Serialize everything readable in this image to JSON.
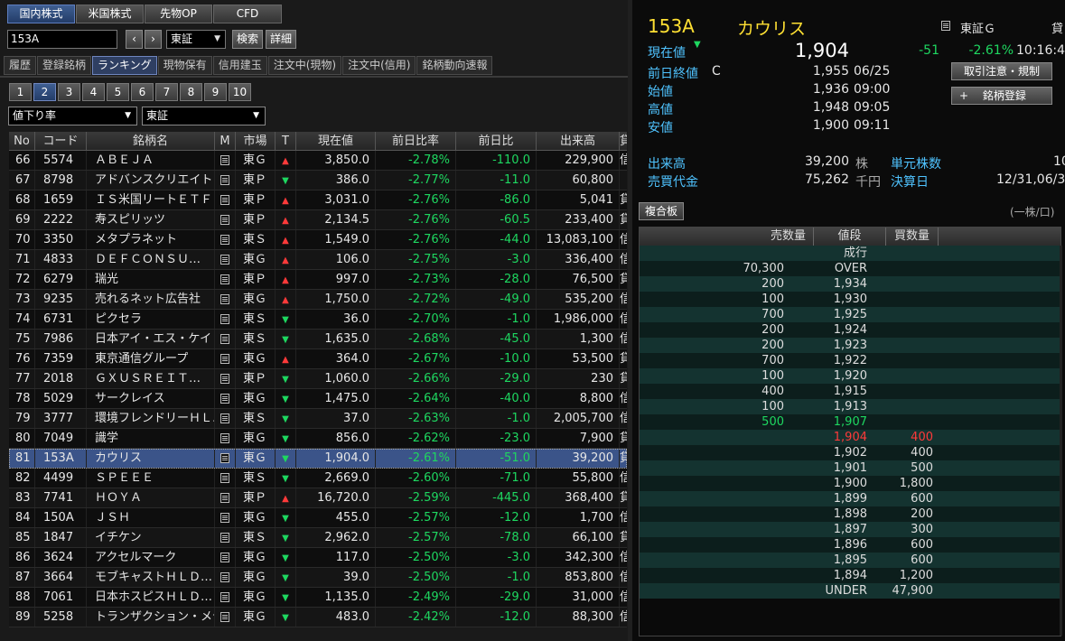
{
  "main_tabs": [
    "国内株式",
    "米国株式",
    "先物OP",
    "CFD"
  ],
  "search": {
    "code": "153A",
    "exchange": "東証",
    "search_label": "検索",
    "detail_label": "詳細"
  },
  "sub_tabs": [
    "履歴",
    "登録銘柄",
    "ランキング",
    "現物保有",
    "信用建玉",
    "注文中(現物)",
    "注文中(信用)",
    "銘柄動向速報"
  ],
  "pages": [
    "1",
    "2",
    "3",
    "4",
    "5",
    "6",
    "7",
    "8",
    "9",
    "10"
  ],
  "filters": {
    "ranking_type": "値下り率",
    "market": "東証"
  },
  "table": {
    "headers": [
      "No",
      "コード",
      "銘柄名",
      "M",
      "市場",
      "T",
      "現在値",
      "前日比率",
      "前日比",
      "出来高",
      "貸"
    ],
    "rows": [
      {
        "no": "66",
        "code": "5574",
        "name": "ＡＢＥＪＡ",
        "market": "東Ｇ",
        "tick": "up",
        "price": "3,850.0",
        "pct": "-2.78%",
        "chg": "-110.0",
        "vol": "229,900",
        "x": "信"
      },
      {
        "no": "67",
        "code": "8798",
        "name": "アドバンスクリエイト",
        "market": "東Ｐ",
        "tick": "down",
        "price": "386.0",
        "pct": "-2.77%",
        "chg": "-11.0",
        "vol": "60,800",
        "x": ""
      },
      {
        "no": "68",
        "code": "1659",
        "name": "ＩＳ米国リートＥＴＦ",
        "market": "東Ｐ",
        "tick": "up",
        "price": "3,031.0",
        "pct": "-2.76%",
        "chg": "-86.0",
        "vol": "5,041",
        "x": "貸"
      },
      {
        "no": "69",
        "code": "2222",
        "name": "寿スピリッツ",
        "market": "東Ｐ",
        "tick": "up",
        "price": "2,134.5",
        "pct": "-2.76%",
        "chg": "-60.5",
        "vol": "233,400",
        "x": "貸"
      },
      {
        "no": "70",
        "code": "3350",
        "name": "メタプラネット",
        "market": "東Ｓ",
        "tick": "up",
        "price": "1,549.0",
        "pct": "-2.76%",
        "chg": "-44.0",
        "vol": "13,083,100",
        "x": "信"
      },
      {
        "no": "71",
        "code": "4833",
        "name": "ＤＥＦＣＯＮＳＵ…",
        "market": "東Ｇ",
        "tick": "up",
        "price": "106.0",
        "pct": "-2.75%",
        "chg": "-3.0",
        "vol": "336,400",
        "x": "信"
      },
      {
        "no": "72",
        "code": "6279",
        "name": "瑞光",
        "market": "東Ｐ",
        "tick": "up",
        "price": "997.0",
        "pct": "-2.73%",
        "chg": "-28.0",
        "vol": "76,500",
        "x": "貸"
      },
      {
        "no": "73",
        "code": "9235",
        "name": "売れるネット広告社",
        "market": "東Ｇ",
        "tick": "up",
        "price": "1,750.0",
        "pct": "-2.72%",
        "chg": "-49.0",
        "vol": "535,200",
        "x": "信"
      },
      {
        "no": "74",
        "code": "6731",
        "name": "ピクセラ",
        "market": "東Ｓ",
        "tick": "down",
        "price": "36.0",
        "pct": "-2.70%",
        "chg": "-1.0",
        "vol": "1,986,000",
        "x": "信"
      },
      {
        "no": "75",
        "code": "7986",
        "name": "日本アイ・エス・ケイ",
        "market": "東Ｓ",
        "tick": "down",
        "price": "1,635.0",
        "pct": "-2.68%",
        "chg": "-45.0",
        "vol": "1,300",
        "x": "信"
      },
      {
        "no": "76",
        "code": "7359",
        "name": "東京通信グループ",
        "market": "東Ｇ",
        "tick": "up",
        "price": "364.0",
        "pct": "-2.67%",
        "chg": "-10.0",
        "vol": "53,500",
        "x": "貸"
      },
      {
        "no": "77",
        "code": "2018",
        "name": "ＧＸＵＳＲＥＩＴ…",
        "market": "東Ｐ",
        "tick": "down",
        "price": "1,060.0",
        "pct": "-2.66%",
        "chg": "-29.0",
        "vol": "230",
        "x": "貸"
      },
      {
        "no": "78",
        "code": "5029",
        "name": "サークレイス",
        "market": "東Ｇ",
        "tick": "down",
        "price": "1,475.0",
        "pct": "-2.64%",
        "chg": "-40.0",
        "vol": "8,800",
        "x": "信"
      },
      {
        "no": "79",
        "code": "3777",
        "name": "環境フレンドリーＨＬ…",
        "market": "東Ｓ",
        "tick": "down",
        "price": "37.0",
        "pct": "-2.63%",
        "chg": "-1.0",
        "vol": "2,005,700",
        "x": "信"
      },
      {
        "no": "80",
        "code": "7049",
        "name": "識学",
        "market": "東Ｇ",
        "tick": "down",
        "price": "856.0",
        "pct": "-2.62%",
        "chg": "-23.0",
        "vol": "7,900",
        "x": "貸"
      },
      {
        "no": "81",
        "code": "153A",
        "name": "カウリス",
        "market": "東Ｇ",
        "tick": "down",
        "price": "1,904.0",
        "pct": "-2.61%",
        "chg": "-51.0",
        "vol": "39,200",
        "x": "貸",
        "selected": true
      },
      {
        "no": "82",
        "code": "4499",
        "name": "ＳＰＥＥＥ",
        "market": "東Ｓ",
        "tick": "down",
        "price": "2,669.0",
        "pct": "-2.60%",
        "chg": "-71.0",
        "vol": "55,800",
        "x": "信"
      },
      {
        "no": "83",
        "code": "7741",
        "name": "ＨＯＹＡ",
        "market": "東Ｐ",
        "tick": "up",
        "price": "16,720.0",
        "pct": "-2.59%",
        "chg": "-445.0",
        "vol": "368,400",
        "x": "貸"
      },
      {
        "no": "84",
        "code": "150A",
        "name": "ＪＳＨ",
        "market": "東Ｇ",
        "tick": "down",
        "price": "455.0",
        "pct": "-2.57%",
        "chg": "-12.0",
        "vol": "1,700",
        "x": "信"
      },
      {
        "no": "85",
        "code": "1847",
        "name": "イチケン",
        "market": "東Ｓ",
        "tick": "down",
        "price": "2,962.0",
        "pct": "-2.57%",
        "chg": "-78.0",
        "vol": "66,100",
        "x": "貸"
      },
      {
        "no": "86",
        "code": "3624",
        "name": "アクセルマーク",
        "market": "東Ｇ",
        "tick": "down",
        "price": "117.0",
        "pct": "-2.50%",
        "chg": "-3.0",
        "vol": "342,300",
        "x": "信"
      },
      {
        "no": "87",
        "code": "3664",
        "name": "モブキャストＨＬＤ…",
        "market": "東Ｇ",
        "tick": "down",
        "price": "39.0",
        "pct": "-2.50%",
        "chg": "-1.0",
        "vol": "853,800",
        "x": "信"
      },
      {
        "no": "88",
        "code": "7061",
        "name": "日本ホスピスＨＬＤ…",
        "market": "東Ｇ",
        "tick": "down",
        "price": "1,135.0",
        "pct": "-2.49%",
        "chg": "-29.0",
        "vol": "31,000",
        "x": "信"
      },
      {
        "no": "89",
        "code": "5258",
        "name": "トランザクション・メデ…",
        "market": "東Ｇ",
        "tick": "down",
        "price": "483.0",
        "pct": "-2.42%",
        "chg": "-12.0",
        "vol": "88,300",
        "x": "信"
      }
    ]
  },
  "quote": {
    "code": "153A",
    "name": "カウリス",
    "market": "東証Ｇ",
    "cut_char": "貸",
    "current_label": "現在値",
    "current_price": "1,904",
    "change": "-51",
    "change_pct": "-2.61%",
    "time": "10:16:4",
    "prev_close_label": "前日終値",
    "prev_close_flag": "C",
    "prev_close": "1,955",
    "prev_close_date": "06/25",
    "open_label": "始値",
    "open": "1,936",
    "open_time": "09:00",
    "high_label": "高値",
    "high": "1,948",
    "high_time": "09:05",
    "low_label": "安値",
    "low": "1,900",
    "low_time": "09:11",
    "volume_label": "出来高",
    "volume": "39,200",
    "volume_unit": "株",
    "turnover_label": "売買代金",
    "turnover": "75,262",
    "turnover_unit": "千円",
    "unit_shares_label": "単元株数",
    "unit_shares": "10",
    "settle_label": "決算日",
    "settle": "12/31,06/3",
    "notice_button": "取引注意・規制",
    "register_button": "銘柄登録",
    "register_plus": "+",
    "board_button": "複合板",
    "board_unit": "(一株/口)"
  },
  "board": {
    "headers": [
      "売数量",
      "値段",
      "買数量"
    ],
    "rows": [
      {
        "sell": "",
        "price": "成行",
        "buy": ""
      },
      {
        "sell": "70,300",
        "price": "OVER",
        "buy": ""
      },
      {
        "sell": "200",
        "price": "1,934",
        "buy": ""
      },
      {
        "sell": "100",
        "price": "1,930",
        "buy": ""
      },
      {
        "sell": "700",
        "price": "1,925",
        "buy": ""
      },
      {
        "sell": "200",
        "price": "1,924",
        "buy": ""
      },
      {
        "sell": "200",
        "price": "1,923",
        "buy": ""
      },
      {
        "sell": "700",
        "price": "1,922",
        "buy": ""
      },
      {
        "sell": "100",
        "price": "1,920",
        "buy": ""
      },
      {
        "sell": "400",
        "price": "1,915",
        "buy": ""
      },
      {
        "sell": "100",
        "price": "1,913",
        "buy": ""
      },
      {
        "sell": "500",
        "price": "1,907",
        "buy": "",
        "sell_green": true,
        "price_green": true
      },
      {
        "sell": "",
        "price": "1,904",
        "buy": "400",
        "red": true
      },
      {
        "sell": "",
        "price": "1,902",
        "buy": "400"
      },
      {
        "sell": "",
        "price": "1,901",
        "buy": "500"
      },
      {
        "sell": "",
        "price": "1,900",
        "buy": "1,800"
      },
      {
        "sell": "",
        "price": "1,899",
        "buy": "600"
      },
      {
        "sell": "",
        "price": "1,898",
        "buy": "200"
      },
      {
        "sell": "",
        "price": "1,897",
        "buy": "300"
      },
      {
        "sell": "",
        "price": "1,896",
        "buy": "600"
      },
      {
        "sell": "",
        "price": "1,895",
        "buy": "600"
      },
      {
        "sell": "",
        "price": "1,894",
        "buy": "1,200"
      },
      {
        "sell": "",
        "price": "UNDER",
        "buy": "47,900"
      }
    ]
  },
  "colors": {
    "up": "#ff3a3a",
    "down": "#1ed760",
    "label": "#4fc3ff",
    "title": "#ffe033"
  }
}
